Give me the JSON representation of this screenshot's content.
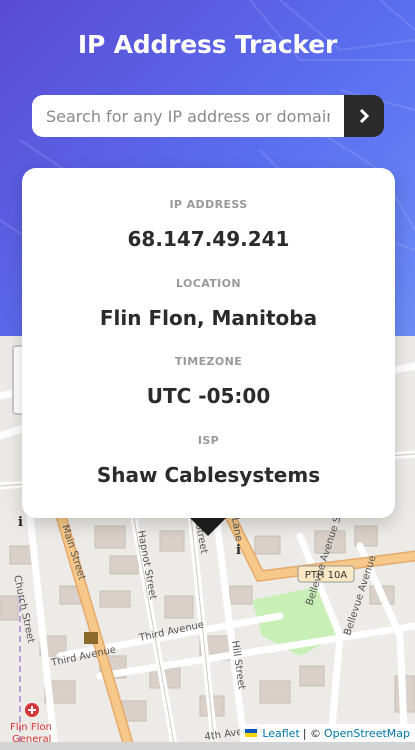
{
  "header": {
    "title": "IP Address Tracker",
    "search_placeholder": "Search for any IP address or domain",
    "search_value": "",
    "submit_icon": "chevron-right-icon"
  },
  "card": {
    "ip_label": "IP ADDRESS",
    "ip_value": "68.147.49.241",
    "location_label": "LOCATION",
    "location_value": "Flin Flon, Manitoba",
    "timezone_label": "TIMEZONE",
    "timezone_value": "UTC -05:00",
    "isp_label": "ISP",
    "isp_value": "Shaw Cablesystems"
  },
  "map": {
    "streets": [
      "Church Street",
      "Main Street",
      "Hapnot Street",
      "Third Avenue",
      "Third Avenue",
      "Hill Street",
      "Bellevue Avenue South",
      "Bellevue Avenue",
      "Street",
      "Lane",
      "4th Avenue"
    ],
    "road_badge": "PTH 10A",
    "poi": [
      "Flin Flon",
      "General"
    ],
    "attribution_leaflet": "Leaflet",
    "attribution_sep": " | © ",
    "attribution_osm": "OpenStreetMap"
  },
  "colors": {
    "gradient_start": "#5a4bd1",
    "gradient_end": "#6b8df6",
    "dark": "#2b2b2b",
    "label_gray": "#9a9a9a",
    "road_orange": "#f6c98a",
    "park_green": "#c8efb6"
  }
}
